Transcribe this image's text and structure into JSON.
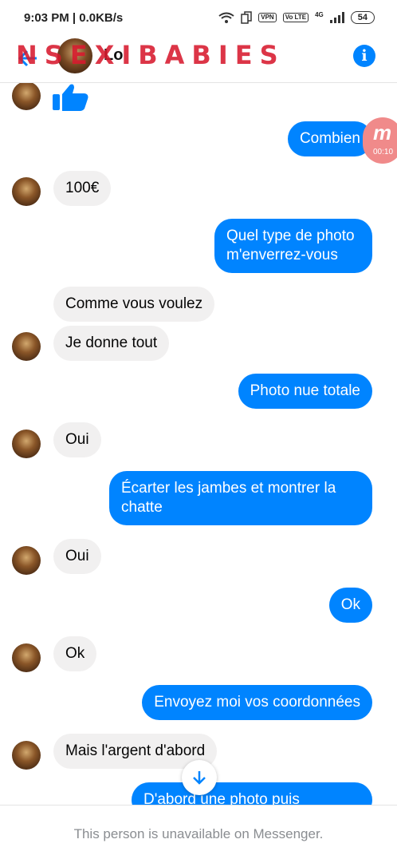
{
  "status_bar": {
    "time": "9:03 PM",
    "network_speed": "0.0KB/s",
    "vpn": "VPN",
    "volte": "Vo LTE",
    "network_type": "4G",
    "battery": "54"
  },
  "header": {
    "contact_name": "Lo",
    "watermark": "NSEXIBABIES",
    "back_icon": "arrow-left-icon",
    "info_icon": "info-icon"
  },
  "floating_badge": {
    "letter": "m",
    "time": "00:10"
  },
  "messages": [
    {
      "sender": "contact",
      "type": "sticker",
      "icon": "thumbs-up-icon"
    },
    {
      "sender": "me",
      "text": "Combien"
    },
    {
      "sender": "contact",
      "text": "100€"
    },
    {
      "sender": "me",
      "text": "Quel type de photo m'enverrez-vous"
    },
    {
      "sender": "contact",
      "text": "Comme vous voulez"
    },
    {
      "sender": "contact",
      "text": "Je donne tout"
    },
    {
      "sender": "me",
      "text": "Photo nue totale"
    },
    {
      "sender": "contact",
      "text": "Oui"
    },
    {
      "sender": "me",
      "text": "Écarter les jambes et montrer la chatte"
    },
    {
      "sender": "contact",
      "text": "Oui"
    },
    {
      "sender": "me",
      "text": "Ok"
    },
    {
      "sender": "contact",
      "text": "Ok"
    },
    {
      "sender": "me",
      "text": "Envoyez moi vos coordonnées"
    },
    {
      "sender": "contact",
      "text": "Mais l'argent d'abord"
    },
    {
      "sender": "me",
      "text": "D'abord une photo puis"
    }
  ],
  "scroll_button_icon": "arrow-down-icon",
  "footer": {
    "notice": "This person is unavailable on Messenger."
  },
  "colors": {
    "accent": "#0084ff",
    "incoming_bubble": "#f1f0f0",
    "watermark": "#d7192d"
  }
}
